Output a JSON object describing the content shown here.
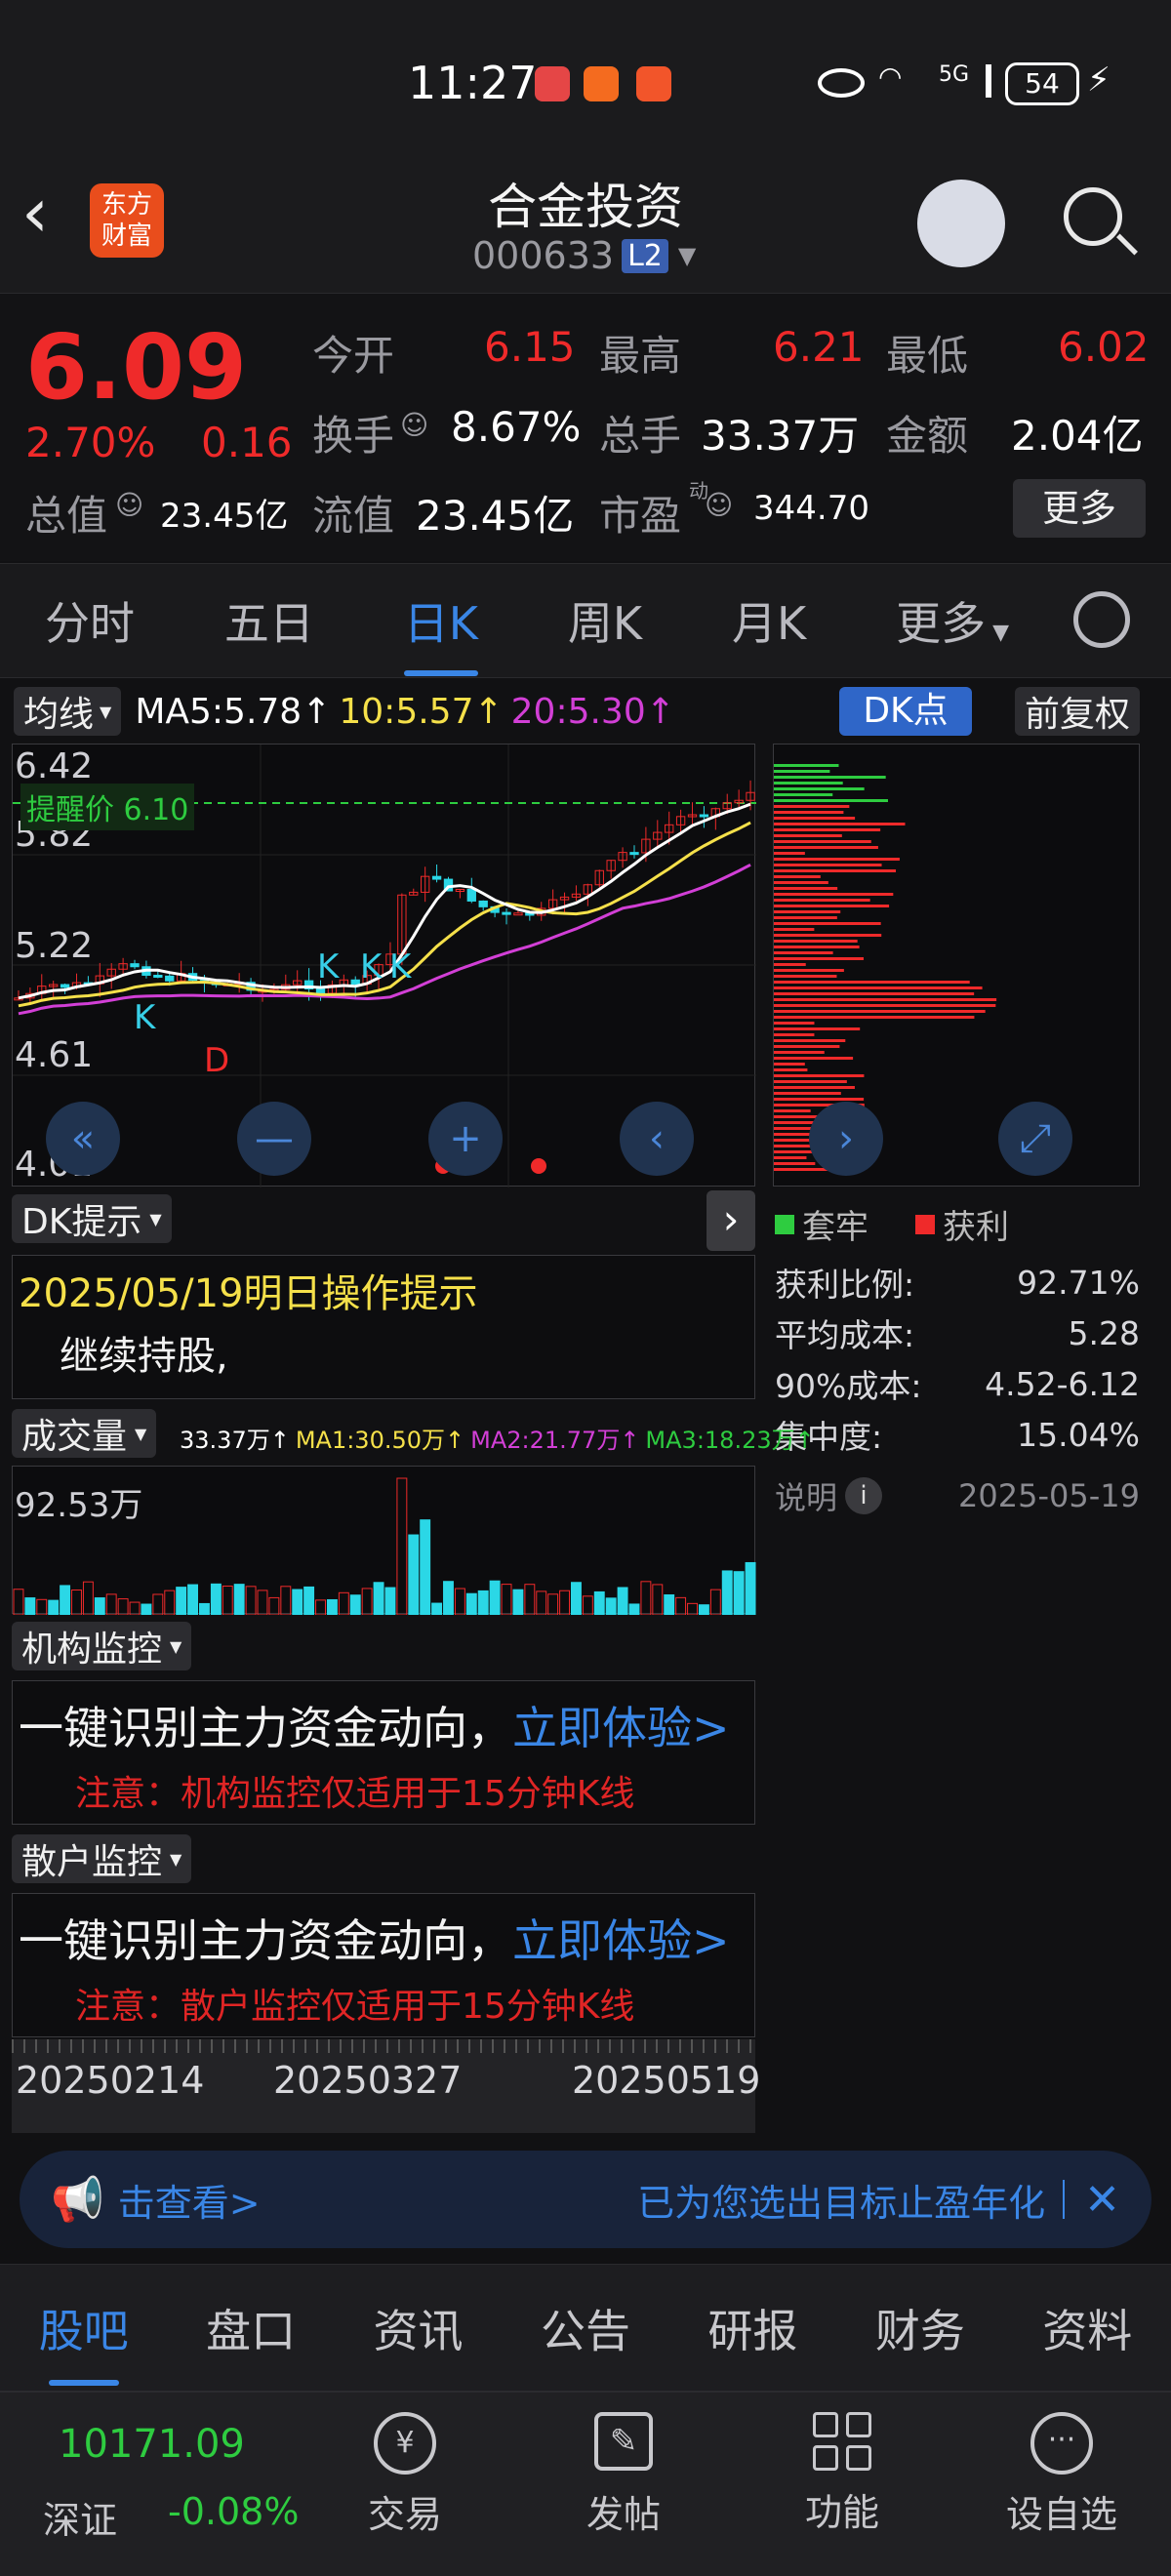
{
  "status_bar": {
    "time": "11:27",
    "battery": "54",
    "network": "5G"
  },
  "header": {
    "brand": "东方\n财富",
    "brand_line1": "东方",
    "brand_line2": "财富",
    "title": "合金投资",
    "code": "000633",
    "level": "L2"
  },
  "quote": {
    "price": "6.09",
    "pct": "2.70%",
    "change": "0.16",
    "open_label": "今开",
    "open": "6.15",
    "high_label": "最高",
    "high": "6.21",
    "low_label": "最低",
    "low": "6.02",
    "turnover_label": "换手",
    "turnover": "8.67%",
    "volume_label": "总手",
    "volume": "33.37万",
    "amount_label": "金额",
    "amount": "2.04亿",
    "mktcap_label": "总值",
    "mktcap": "23.45亿",
    "float_label": "流值",
    "float": "23.45亿",
    "pe_label": "市盈",
    "pe_sup": "动",
    "pe": "344.70",
    "more": "更多"
  },
  "tabs": [
    "分时",
    "五日",
    "日K",
    "周K",
    "月K",
    "更多"
  ],
  "indicator": {
    "ma_label": "均线",
    "ma5": "MA5:5.78↑",
    "ma10": "10:5.57↑",
    "ma20": "20:5.30↑",
    "dk_button": "DK点",
    "adjust": "前复权"
  },
  "kline": {
    "y_labels": [
      "6.42",
      "5.82",
      "5.22",
      "4.61",
      "4.01"
    ],
    "alert_label": "提醒价 6.10",
    "markers": [
      "K",
      "K",
      "K",
      "K",
      "D"
    ]
  },
  "chip_dist": {
    "legend_trapped": "套牢",
    "legend_profit": "获利",
    "rows": [
      {
        "label": "获利比例:",
        "value": "92.71%"
      },
      {
        "label": "平均成本:",
        "value": "5.28"
      },
      {
        "label": "90%成本:",
        "value": "4.52-6.12"
      },
      {
        "label": "集中度:",
        "value": "15.04%"
      }
    ],
    "explain": "说明",
    "date": "2025-05-19"
  },
  "dk_tip": {
    "label": "DK提示",
    "headline": "2025/05/19明日操作提示",
    "text": "继续持股,"
  },
  "volume": {
    "label": "成交量",
    "v": "33.37万↑",
    "ma1": "MA1:30.50万↑",
    "ma2": "MA2:21.77万↑",
    "ma3": "MA3:18.23万↑",
    "max_label": "92.53万"
  },
  "inst_monitor": {
    "label": "机构监控",
    "main": "一键识别主力资金动向，",
    "link": "立即体验>",
    "note": "注意：机构监控仅适用于15分钟K线"
  },
  "retail_monitor": {
    "label": "散户监控",
    "main": "一键识别主力资金动向，",
    "link": "立即体验>",
    "note": "注意：散户监控仅适用于15分钟K线"
  },
  "dates": [
    "20250214",
    "20250327",
    "20250519"
  ],
  "banner": {
    "left": "击查看>",
    "right": "已为您选出目标止盈年化"
  },
  "bottom_nav": [
    "股吧",
    "盘口",
    "资讯",
    "公告",
    "研报",
    "财务",
    "资料"
  ],
  "dock": {
    "index_value": "10171.09",
    "index_name": "深证",
    "index_change": "-0.08%",
    "items": [
      "交易",
      "发帖",
      "功能",
      "设自选"
    ]
  },
  "colors": {
    "up": "#ef2a2a",
    "down": "#2ecc40",
    "accent": "#3a86e6",
    "ma5": "#ffffff",
    "ma10": "#f5e04a",
    "ma20": "#d23fd6"
  }
}
